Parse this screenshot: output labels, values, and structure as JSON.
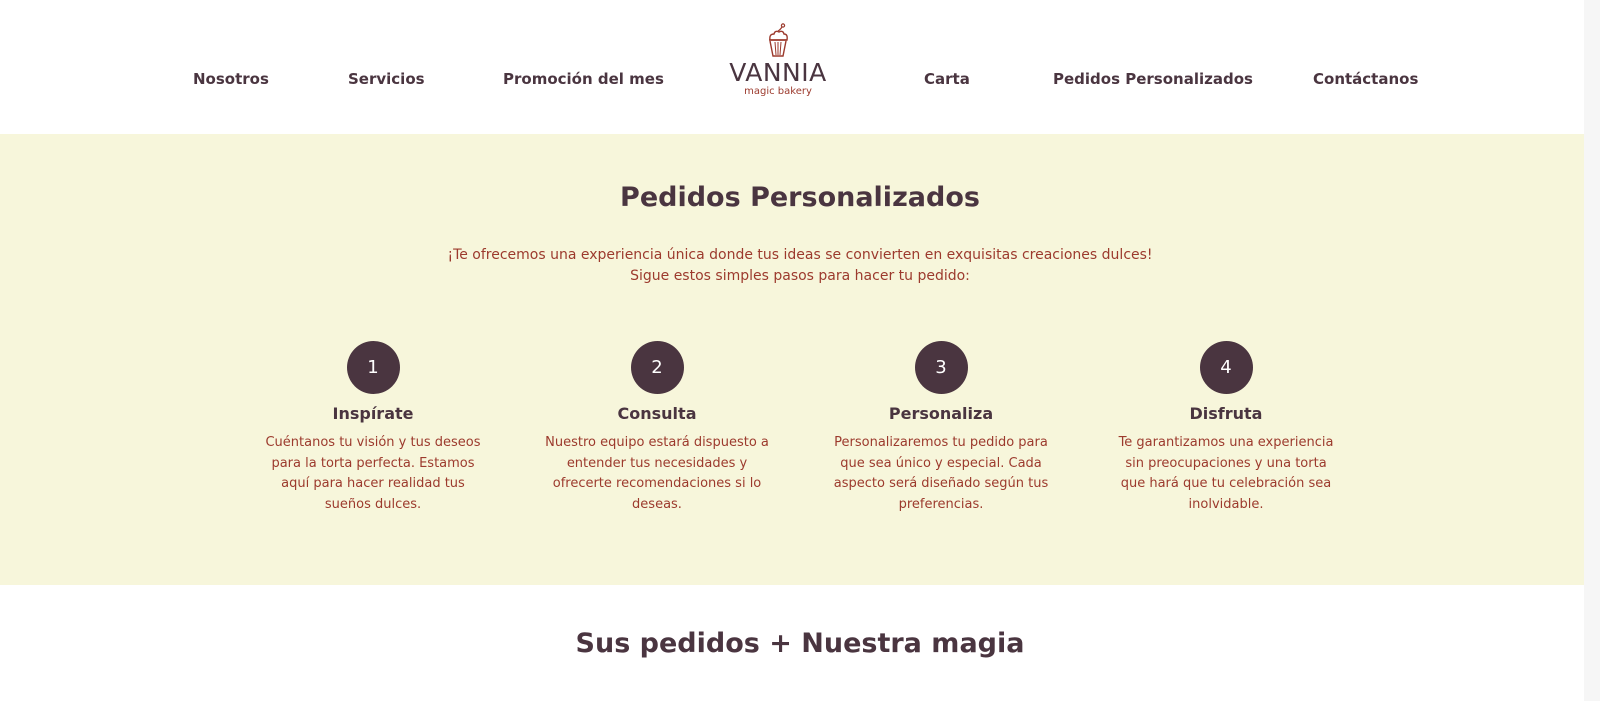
{
  "nav": {
    "left": [
      "Nosotros",
      "Servicios",
      "Promoción del mes"
    ],
    "right": [
      "Carta",
      "Pedidos Personalizados",
      "Contáctanos"
    ]
  },
  "logo": {
    "icon": "cupcake-icon",
    "title": "VANNIA",
    "subtitle": "magic bakery"
  },
  "section": {
    "title": "Pedidos Personalizados",
    "intro_line1": "¡Te ofrecemos una experiencia única donde tus ideas se convierten en exquisitas creaciones dulces!",
    "intro_line2": "Sigue estos simples pasos para hacer tu pedido:",
    "steps": [
      {
        "number": "1",
        "title": "Inspírate",
        "description": "Cuéntanos tu visión y tus deseos para la torta perfecta. Estamos aquí para hacer realidad tus sueños dulces."
      },
      {
        "number": "2",
        "title": "Consulta",
        "description": "Nuestro equipo estará dispuesto a entender tus necesidades y ofrecerte recomendaciones si lo deseas."
      },
      {
        "number": "3",
        "title": "Personaliza",
        "description": "Personalizaremos tu pedido para que sea único y especial. Cada aspecto será diseñado según tus preferencias."
      },
      {
        "number": "4",
        "title": "Disfruta",
        "description": "Te garantizamos una experiencia sin preocupaciones y una torta que hará que tu celebración sea inolvidable."
      }
    ]
  },
  "bottom": {
    "title": "Sus pedidos + Nuestra magia"
  },
  "colors": {
    "primary": "#4a3540",
    "accent": "#9c3a2d",
    "section_bg": "#f7f6db",
    "background": "#ffffff"
  }
}
